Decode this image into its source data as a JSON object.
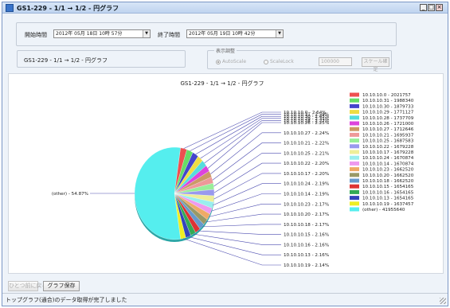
{
  "window": {
    "title": "GS1-229 - 1/1 → 1/2 - 円グラフ",
    "minimize_glyph": "_",
    "maximize_glyph": "□",
    "close_glyph": "×"
  },
  "time_range": {
    "start_label": "開始時間",
    "start_value": "2012年 05月 18日 10時 57分",
    "end_label": "終了時間",
    "end_value": "2012年 05月 19日 10時 42分"
  },
  "path_label": "GS1-229 - 1/1 → 1/2 - 円グラフ",
  "display_adjust": {
    "title": "表示調整",
    "autoscale_label": "AutoScale",
    "autoscale_checked": true,
    "scalelock_label": "ScaleLock",
    "scalelock_checked": false,
    "scale_value": "100000",
    "confirm_label": "スケール確定"
  },
  "chart_data": {
    "type": "pie",
    "title": "GS1-229 - 1/1 → 1/2 - 円グラフ",
    "legend_position": "right",
    "slices": [
      {
        "label": "10.10.10.0",
        "value": 2021757,
        "pct": "2.64%",
        "color": "#ee5050"
      },
      {
        "label": "10.10.10.31",
        "value": 1988340,
        "pct": "2.59%",
        "color": "#66dd66"
      },
      {
        "label": "10.10.10.30",
        "value": 1879733,
        "pct": "2.45%",
        "color": "#4444cc"
      },
      {
        "label": "10.10.10.29",
        "value": 1771127,
        "pct": "2.31%",
        "color": "#eedd44"
      },
      {
        "label": "10.10.10.28",
        "value": 1737709,
        "pct": "2.27%",
        "color": "#55dddd"
      },
      {
        "label": "10.10.10.26",
        "value": 1721000,
        "pct": "2.25%",
        "color": "#dd44dd"
      },
      {
        "label": "10.10.10.27",
        "value": 1712646,
        "pct": "2.24%",
        "color": "#cc9966"
      },
      {
        "label": "10.10.10.21",
        "value": 1695937,
        "pct": "2.22%",
        "color": "#ee9999"
      },
      {
        "label": "10.10.10.25",
        "value": 1687583,
        "pct": "2.21%",
        "color": "#99ee99"
      },
      {
        "label": "10.10.10.22",
        "value": 1679228,
        "pct": "2.20%",
        "color": "#9999ee"
      },
      {
        "label": "10.10.10.17",
        "value": 1679228,
        "pct": "2.20%",
        "color": "#eeee99"
      },
      {
        "label": "10.10.10.24",
        "value": 1670874,
        "pct": "2.19%",
        "color": "#99eeee"
      },
      {
        "label": "10.10.10.14",
        "value": 1670874,
        "pct": "2.19%",
        "color": "#ee99ee"
      },
      {
        "label": "10.10.10.23",
        "value": 1662520,
        "pct": "2.17%",
        "color": "#eeaa66"
      },
      {
        "label": "10.10.10.20",
        "value": 1662520,
        "pct": "2.17%",
        "color": "#999966"
      },
      {
        "label": "10.10.10.18",
        "value": 1662520,
        "pct": "2.17%",
        "color": "#6699cc"
      },
      {
        "label": "10.10.10.15",
        "value": 1654165,
        "pct": "2.16%",
        "color": "#dd3333"
      },
      {
        "label": "10.10.10.16",
        "value": 1654165,
        "pct": "2.16%",
        "color": "#33aa55"
      },
      {
        "label": "10.10.10.13",
        "value": 1654165,
        "pct": "2.16%",
        "color": "#3344bb"
      },
      {
        "label": "10.10.10.19",
        "value": 1637457,
        "pct": "2.14%",
        "color": "#eeee22"
      },
      {
        "label": "(other)",
        "value": 41955640,
        "pct": "54.87%",
        "color": "#55eeee"
      }
    ]
  },
  "buttons": {
    "back_label": "ひとつ前に戻る",
    "save_label": "グラフ保存"
  },
  "status_text": "トップグラフ(通合)のデータ取得が完了しました"
}
